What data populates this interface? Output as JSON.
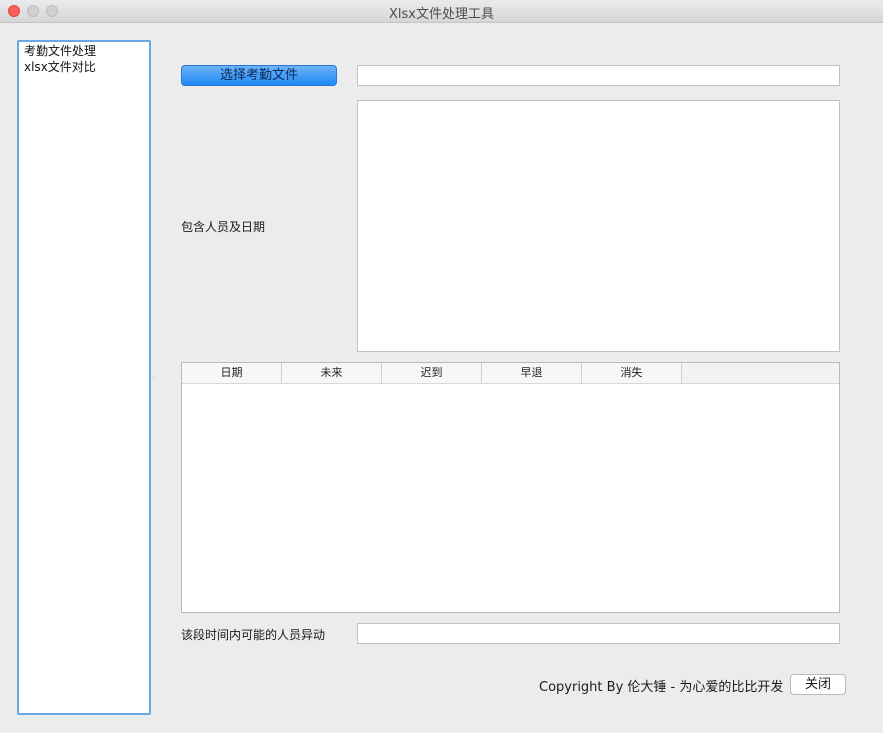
{
  "window": {
    "title": "Xlsx文件处理工具"
  },
  "sidebar": {
    "items": [
      {
        "label": "考勤文件处理"
      },
      {
        "label": "xlsx文件对比"
      }
    ]
  },
  "main": {
    "select_button_label": "选择考勤文件",
    "file_path_value": "",
    "persons_dates_label": "包含人员及日期",
    "persons_dates_value": "",
    "table": {
      "columns": [
        "日期",
        "未来",
        "迟到",
        "早退",
        "消失"
      ],
      "rows": []
    },
    "changes_label": "该段时间内可能的人员异动",
    "changes_value": ""
  },
  "footer": {
    "copyright": "Copyright By 伦大锤 - 为心爱的比比开发",
    "close_label": "关闭"
  },
  "colors": {
    "accent": "#1f8af5",
    "focus_border": "#6aa8e4",
    "close_light": "#fc605c"
  }
}
